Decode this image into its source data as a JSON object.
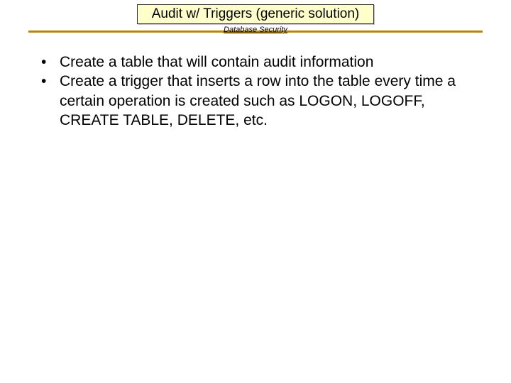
{
  "header": {
    "title": "Audit w/ Triggers (generic solution)",
    "subtitle": "Database Security"
  },
  "content": {
    "bullets": [
      "Create a table that will contain audit information",
      "Create a trigger that inserts a row into the table every time a certain operation is created such as LOGON, LOGOFF, CREATE TABLE, DELETE, etc."
    ]
  }
}
